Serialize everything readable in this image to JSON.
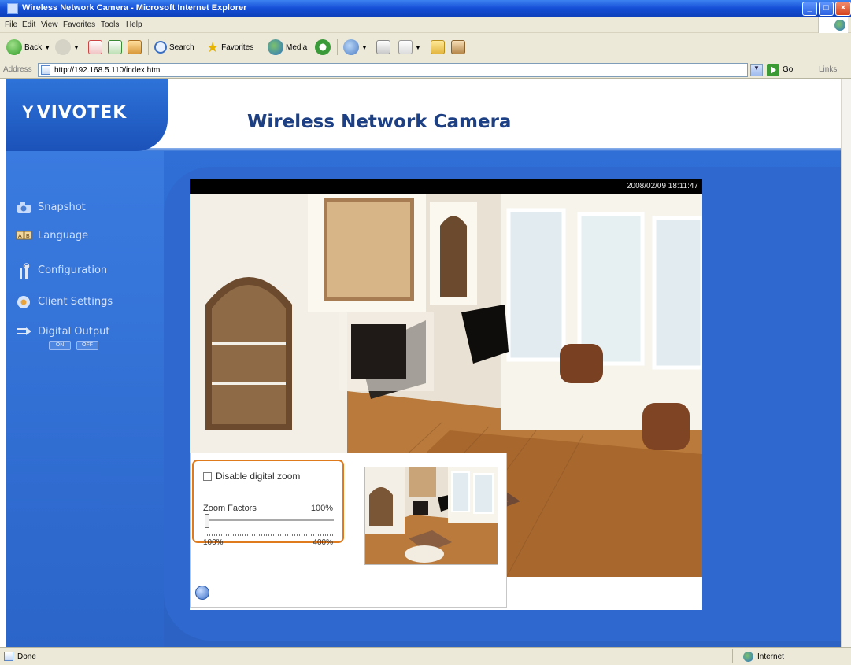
{
  "window": {
    "title": "Wireless Network Camera - Microsoft Internet Explorer",
    "minimize": "_",
    "maximize": "□",
    "close": "×"
  },
  "menu": [
    "File",
    "Edit",
    "View",
    "Favorites",
    "Tools",
    "Help"
  ],
  "toolbar": {
    "back": "Back",
    "search": "Search",
    "favorites": "Favorites",
    "media": "Media"
  },
  "address": {
    "label": "Address",
    "url": "http://192.168.5.110/index.html",
    "go": "Go",
    "links": "Links"
  },
  "header": {
    "logo": "VIVOTEK",
    "title": "Wireless Network Camera"
  },
  "nav": {
    "snapshot": "Snapshot",
    "language": "Language",
    "configuration": "Configuration",
    "client_settings": "Client Settings",
    "digital_output": "Digital Output",
    "on": "ON",
    "off": "OFF"
  },
  "video": {
    "timestamp": "2008/02/09 18:11:47"
  },
  "zoom": {
    "disable_label": "Disable digital zoom",
    "disabled": false,
    "factor_label": "Zoom Factors",
    "factor_value": "100%",
    "min": "100%",
    "max": "400%",
    "level": 0.0
  },
  "status": {
    "text": "Done",
    "zone": "Internet"
  }
}
